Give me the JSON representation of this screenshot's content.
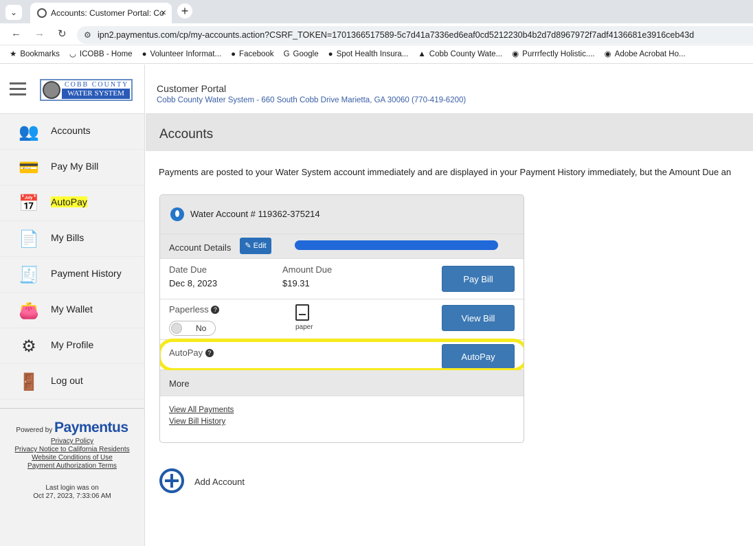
{
  "browser": {
    "tab_title": "Accounts: Customer Portal: Co",
    "tab_close": "×",
    "new_tab": "+",
    "url": "ipn2.paymentus.com/cp/my-accounts.action?CSRF_TOKEN=1701366517589-5c7d41a7336ed6eaf0cd5212230b4b2d7d8967972f7adf4136681e3916ceb43d",
    "bookmarks": [
      {
        "label": "Bookmarks",
        "icon": "★"
      },
      {
        "label": "ICOBB - Home",
        "icon": "◡"
      },
      {
        "label": "Volunteer Informat...",
        "icon": "●"
      },
      {
        "label": "Facebook",
        "icon": "●"
      },
      {
        "label": "Google",
        "icon": "G"
      },
      {
        "label": "Spot Health Insura...",
        "icon": "●"
      },
      {
        "label": "Cobb County Wate...",
        "icon": "▲"
      },
      {
        "label": "Purrrfectly Holistic....",
        "icon": "◉"
      },
      {
        "label": "Adobe Acrobat Ho...",
        "icon": "◉"
      }
    ]
  },
  "logo": {
    "top": "COBB COUNTY",
    "bottom": "WATER SYSTEM"
  },
  "header": {
    "title": "Customer Portal",
    "subtitle": "Cobb County Water System - 660 South Cobb Drive Marietta, GA 30060 (770-419-6200)"
  },
  "sidebar": {
    "items": [
      {
        "label": "Accounts",
        "icon": "👥"
      },
      {
        "label": "Pay My Bill",
        "icon": "💳"
      },
      {
        "label": "AutoPay",
        "icon": "📅"
      },
      {
        "label": "My Bills",
        "icon": "📄"
      },
      {
        "label": "Payment History",
        "icon": "🧾"
      },
      {
        "label": "My Wallet",
        "icon": "👛"
      },
      {
        "label": "My Profile",
        "icon": "⚙"
      },
      {
        "label": "Log out",
        "icon": "🚪"
      }
    ],
    "powered_by": "Powered by",
    "brand": "Paymentus",
    "links": [
      "Privacy Policy",
      "Privacy Notice to California Residents",
      "Website Conditions of Use",
      "Payment Authorization Terms"
    ],
    "last_login_label": "Last login was on",
    "last_login_value": "Oct 27, 2023, 7:33:06 AM"
  },
  "page": {
    "title": "Accounts",
    "notice": "Payments are posted to your Water System account immediately and are displayed in your Payment History immediately, but the Amount Due an"
  },
  "account": {
    "number": "Water Account # 119362-375214",
    "details_label": "Account Details",
    "edit_label": "Edit",
    "date_due_label": "Date Due",
    "date_due": "Dec 8, 2023",
    "amount_due_label": "Amount Due",
    "amount_due": "$19.31",
    "pay_bill": "Pay Bill",
    "paperless_label": "Paperless",
    "paperless_toggle": "No",
    "paper_label": "paper",
    "view_bill": "View Bill",
    "autopay_label": "AutoPay",
    "autopay_button": "AutoPay",
    "more_label": "More",
    "links": [
      "View All Payments",
      "View Bill History"
    ]
  },
  "add_account": "Add Account",
  "colors": {
    "accent": "#3c78b4",
    "highlight": "#f7ea1e",
    "brand_blue": "#1f4fa6"
  }
}
